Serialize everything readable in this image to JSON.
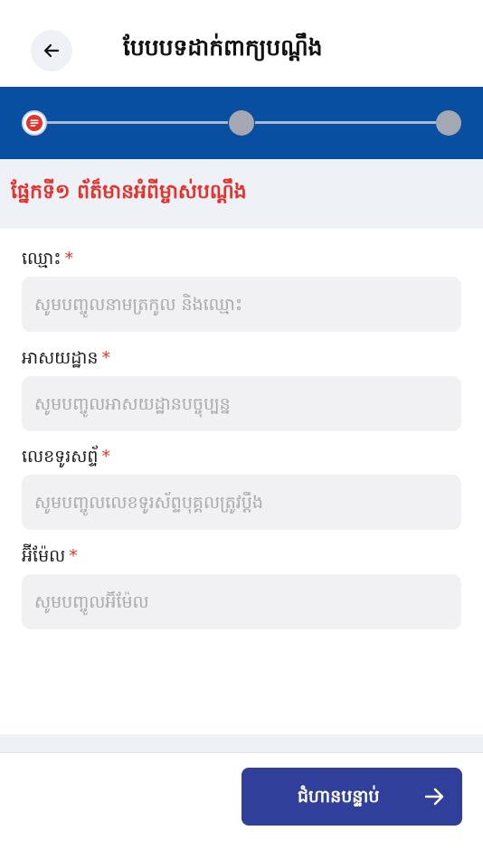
{
  "header": {
    "title": "បែបបទដាក់ពាក្យបណ្តឹង",
    "back_icon": "arrow-left-icon"
  },
  "stepper": {
    "steps": 3,
    "current_step": 1,
    "active_icon": "list-icon",
    "colors": {
      "background": "#084ea1",
      "inactive_dot": "#a3a8b2",
      "line": "#a9b9cf"
    }
  },
  "section": {
    "title": "ផ្នែកទី១ ព័ត៏មានអំពីម្ចាស់បណ្តឹង"
  },
  "form": {
    "fields": [
      {
        "label": "ឈ្មោះ",
        "required_mark": "*",
        "value": "",
        "placeholder": "សូមបញ្ចូលនាមត្រកូល និងឈ្មោះ"
      },
      {
        "label": "អាសយដ្ឋាន",
        "required_mark": "*",
        "value": "",
        "placeholder": "សូមបញ្ចូលអាសយដ្ឋានបច្ចុប្បន្ន"
      },
      {
        "label": "លេខទូរសព្ទ័",
        "required_mark": "*",
        "value": "",
        "placeholder": "សូមបញ្ចូលលេខទូរស័ព្ទបុគ្គលត្រូវប្តឹង"
      },
      {
        "label": "អ៊ីម៉ែល",
        "required_mark": "*",
        "value": "",
        "placeholder": "សូមបញ្ចូលអ៊ីម៉ែល"
      }
    ]
  },
  "footer": {
    "next_label": "ជំហានបន្ទាប់",
    "next_icon": "arrow-right-icon",
    "button_color": "#30409a"
  },
  "colors": {
    "accent_red": "#e2342e"
  }
}
